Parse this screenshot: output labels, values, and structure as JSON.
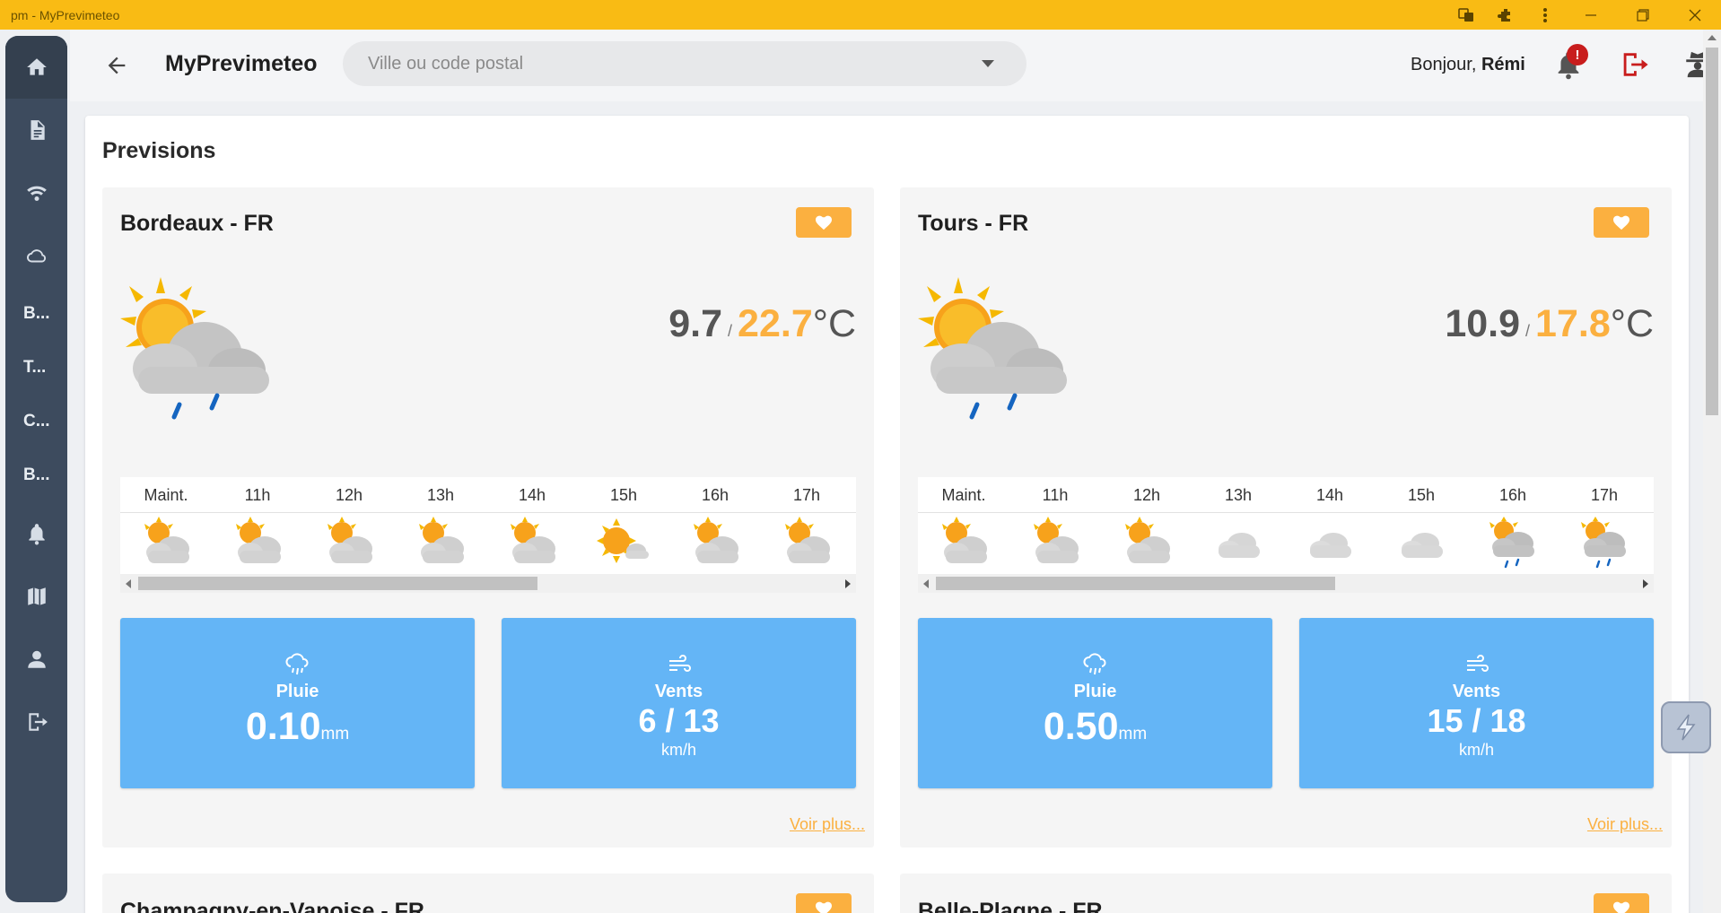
{
  "window": {
    "title": "pm - MyPrevimeteo"
  },
  "appbar": {
    "brand": "MyPrevimeteo",
    "search_placeholder": "Ville ou code postal",
    "greeting_prefix": "Bonjour, ",
    "user_name": "Rémi",
    "notification_badge": "!"
  },
  "sidebar": {
    "items": [
      {
        "icon": "home-icon"
      },
      {
        "icon": "document-icon"
      },
      {
        "icon": "wifi-icon"
      },
      {
        "icon": "cloud-icon"
      },
      {
        "label": "B..."
      },
      {
        "label": "T..."
      },
      {
        "label": "C..."
      },
      {
        "label": "B..."
      },
      {
        "icon": "bell-icon"
      },
      {
        "icon": "map-icon"
      },
      {
        "icon": "user-icon"
      },
      {
        "icon": "logout-icon"
      }
    ]
  },
  "main": {
    "title": "Previsions",
    "more_label": "Voir plus...",
    "cards": [
      {
        "city": "Bordeaux - FR",
        "tmin": "9.7",
        "tmax": "22.7",
        "unit": "°C",
        "hours": [
          "Maint.",
          "11h",
          "12h",
          "13h",
          "14h",
          "15h",
          "16h",
          "17h"
        ],
        "hour_icons": [
          "partly-cloudy",
          "partly-cloudy",
          "partly-cloudy",
          "partly-cloudy",
          "partly-cloudy",
          "sunny-cloud",
          "partly-cloudy",
          "partly-cloudy"
        ],
        "rain_label": "Pluie",
        "rain_value": "0.10",
        "rain_unit": "mm",
        "wind_label": "Vents",
        "wind_value": "6 / 13",
        "wind_unit": "km/h"
      },
      {
        "city": "Tours - FR",
        "tmin": "10.9",
        "tmax": "17.8",
        "unit": "°C",
        "hours": [
          "Maint.",
          "11h",
          "12h",
          "13h",
          "14h",
          "15h",
          "16h",
          "17h"
        ],
        "hour_icons": [
          "partly-cloudy",
          "partly-cloudy",
          "partly-cloudy",
          "cloudy",
          "cloudy",
          "cloudy",
          "sun-cloud-rain",
          "sun-cloud-rain"
        ],
        "rain_label": "Pluie",
        "rain_value": "0.50",
        "rain_unit": "mm",
        "wind_label": "Vents",
        "wind_value": "15 / 18",
        "wind_unit": "km/h"
      }
    ],
    "next_cards": [
      {
        "city": "Champagny-en-Vanoise - FR"
      },
      {
        "city": "Belle-Plagne - FR"
      }
    ]
  },
  "colors": {
    "titlebar": "#f9bb14",
    "sidebar": "#3d4b5e",
    "accent": "#fbb040",
    "stat_tile": "#64b5f6",
    "logout": "#c81d1d"
  }
}
